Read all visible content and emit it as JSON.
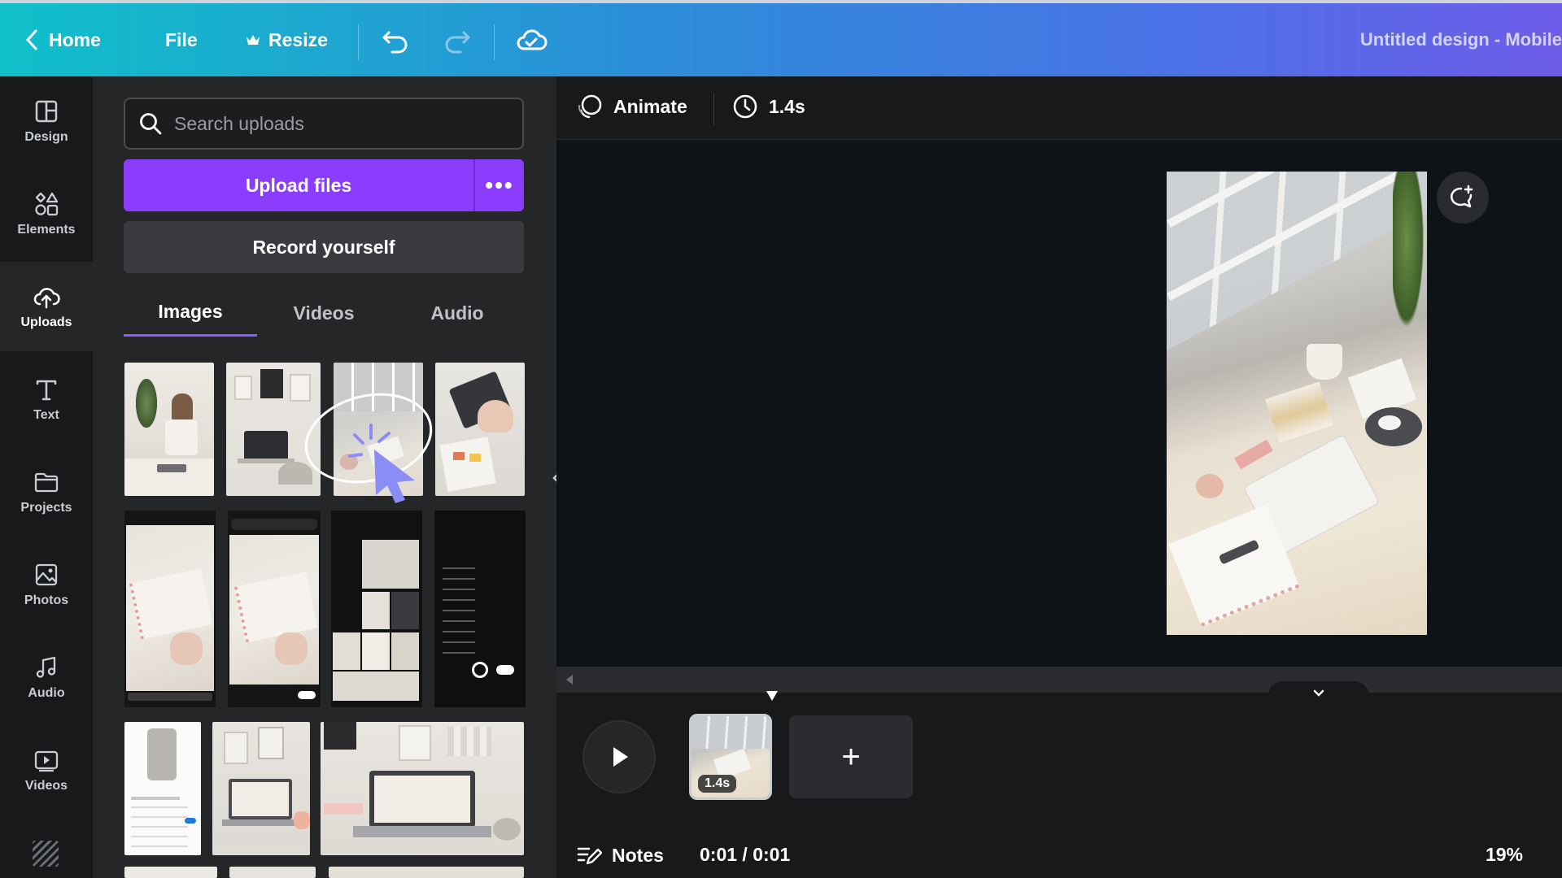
{
  "topbar": {
    "home_label": "Home",
    "file_label": "File",
    "resize_label": "Resize",
    "design_title": "Untitled design - Mobile"
  },
  "rail": {
    "items": [
      {
        "label": "Design",
        "icon": "layout-icon"
      },
      {
        "label": "Elements",
        "icon": "shapes-icon"
      },
      {
        "label": "Uploads",
        "icon": "cloud-upload-icon",
        "active": true
      },
      {
        "label": "Text",
        "icon": "text-icon"
      },
      {
        "label": "Projects",
        "icon": "folder-icon"
      },
      {
        "label": "Photos",
        "icon": "image-icon"
      },
      {
        "label": "Audio",
        "icon": "music-icon"
      },
      {
        "label": "Videos",
        "icon": "video-icon"
      }
    ]
  },
  "uploads": {
    "search_placeholder": "Search uploads",
    "upload_button": "Upload files",
    "more_label": "•••",
    "record_button": "Record yourself",
    "tabs": [
      "Images",
      "Videos",
      "Audio"
    ],
    "active_tab": "Images"
  },
  "editor": {
    "animate_label": "Animate",
    "duration_label": "1.4s"
  },
  "timeline": {
    "clip_duration": "1.4s",
    "add_label": "+",
    "notes_label": "Notes",
    "time_label": "0:01 / 0:01",
    "zoom_label": "19%"
  },
  "colors": {
    "accent": "#8b3dff",
    "topbar_start": "#10c0c9",
    "topbar_end": "#6d5ce8"
  }
}
